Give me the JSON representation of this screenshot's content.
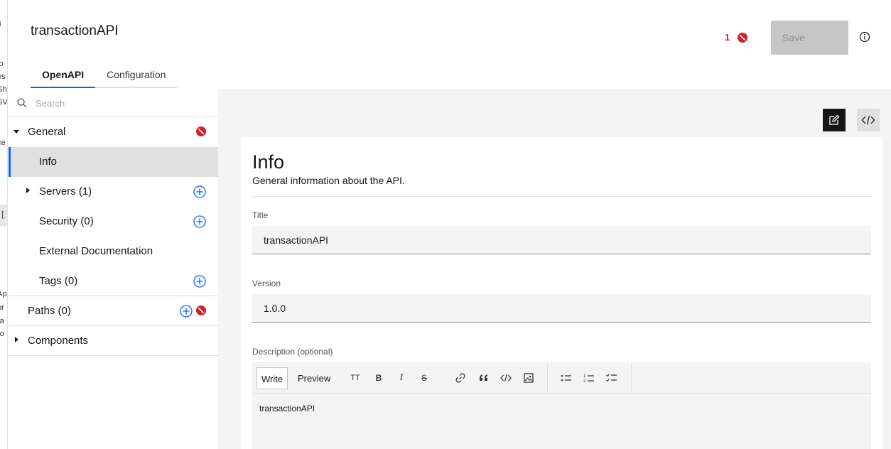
{
  "header": {
    "api_title": "transactionAPI",
    "tabs": [
      {
        "label": "OpenAPI",
        "active": true
      },
      {
        "label": "Configuration",
        "active": false
      }
    ],
    "error_count": "1",
    "save_label": "Save"
  },
  "sidebar": {
    "search_placeholder": "Search",
    "general": {
      "label": "General",
      "has_error": true
    },
    "items": [
      {
        "label": "Info",
        "selected": true
      },
      {
        "label": "Servers (1)"
      },
      {
        "label": "Security (0)"
      },
      {
        "label": "External Documentation"
      },
      {
        "label": "Tags (0)"
      }
    ],
    "paths": {
      "label": "Paths (0)",
      "has_error": true
    },
    "components": {
      "label": "Components"
    }
  },
  "main": {
    "title": "Info",
    "subtitle": "General information about the API.",
    "fields": {
      "title_label": "Title",
      "title_value": "transactionAPI",
      "version_label": "Version",
      "version_value": "1.0.0",
      "description_label": "Description (optional)",
      "description_value": "transactionAPI"
    },
    "editor": {
      "write_label": "Write",
      "preview_label": "Preview",
      "heading_tool": "TT",
      "bold_tool": "B",
      "italic_tool": "I",
      "strike_tool": "S"
    }
  },
  "background_text": [
    "ti",
    "lo",
    "es",
    "Sh",
    "SV",
    "ce",
    ": [",
    "Ap",
    "or",
    "ra",
    "ro"
  ],
  "colors": {
    "accent": "#0f62fe",
    "error": "#da1e28",
    "disabled_bg": "#c6c6c6",
    "panel_bg": "#f4f4f4"
  }
}
